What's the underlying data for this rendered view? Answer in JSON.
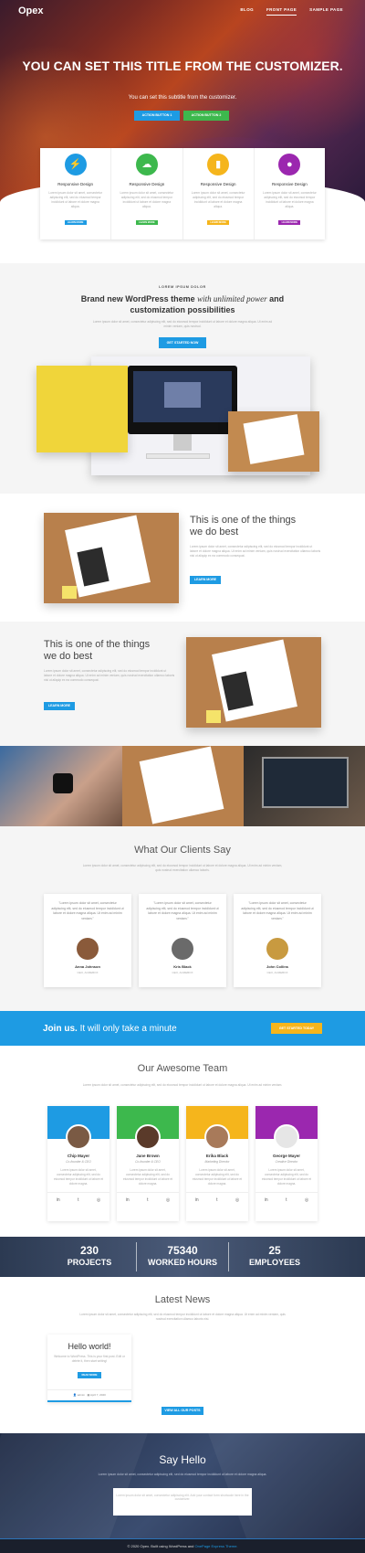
{
  "header": {
    "logo": "Opex",
    "nav": [
      "BLOG",
      "FRONT PAGE",
      "SAMPLE PAGE"
    ]
  },
  "hero": {
    "title": "YOU CAN SET THIS TITLE FROM THE CUSTOMIZER.",
    "subtitle": "You can set this subtitle from the customizer.",
    "button1": "ACTION BUTTON 1",
    "button2": "ACTION BUTTON 2"
  },
  "features": [
    {
      "title": "Responsive Design",
      "desc": "Lorem ipsum dolor sit amet, consectetur adipiscing elit, sed do eiusmod tempor incididunt ut labore et dolore magna aliqua.",
      "button": "LEARN MORE",
      "color": "#1e9be3",
      "icon": "lightning-icon"
    },
    {
      "title": "Responsive Design",
      "desc": "Lorem ipsum dolor sit amet, consectetur adipiscing elit, sed do eiusmod tempor incididunt ut labore et dolore magna aliqua.",
      "button": "LEARN MORE",
      "color": "#3db84d",
      "icon": "cloud-icon"
    },
    {
      "title": "Responsive Design",
      "desc": "Lorem ipsum dolor sit amet, consectetur adipiscing elit, sed do eiusmod tempor incididunt ut labore et dolore magna aliqua.",
      "button": "LEARN MORE",
      "color": "#f5b51c",
      "icon": "signal-bars-icon"
    },
    {
      "title": "Responsive Design",
      "desc": "Lorem ipsum dolor sit amet, consectetur adipiscing elit, sed do eiusmod tempor incididunt ut labore et dolore magna aliqua.",
      "button": "LEARN MORE",
      "color": "#9b27af",
      "icon": "user-icon"
    }
  ],
  "intro": {
    "eyebrow": "LOREM IPSUM DOLOR",
    "headline_a": "Brand new WordPress theme ",
    "headline_italic": "with unlimited power",
    "headline_b": " and customization possibilities",
    "text": "Lorem ipsum dolor sit amet, consectetur adipiscing elit, sed do eiusmod tempor incididunt ut labore et dolore magna aliqua. Ut enim ad minim veniam, quis nostrud.",
    "button": "GET STARTED NOW"
  },
  "row1": {
    "title": "This is one of the things we do best",
    "text": "Lorem ipsum dolor sit amet, consectetur adipiscing elit, sed do eiusmod tempor incididunt ut labore et dolore magna aliqua. Ut enim ad minim veniam, quis nostrud exercitation ullamco laboris nisi ut aliquip ex ea commodo consequat.",
    "button": "LEARN MORE"
  },
  "row2": {
    "title": "This is one of the things we do best",
    "text": "Lorem ipsum dolor sit amet, consectetur adipiscing elit, sed do eiusmod tempor incididunt ut labore et dolore magna aliqua. Ut enim ad minim veniam, quis nostrud exercitation ullamco laboris nisi ut aliquip ex ea commodo consequat.",
    "button": "LEARN MORE"
  },
  "clients": {
    "title": "What Our Clients Say",
    "sub": "Lorem ipsum dolor sit amet, consectetur adipiscing elit, sed do eiusmod tempor incididunt ut labore et dolore magna aliqua. Ut enim ad minim veniam, quis nostrud exercitation ullamco laboris.",
    "items": [
      {
        "quote": "\"Lorem ipsum dolor sit amet, consectetur adipiscing elit, sed do eiusmod tempor incididunt ut labore et dolore magna aliqua. Ut enim ad minim veniam.\"",
        "name": "Anna Johnson",
        "role": "CEO, ACMEBOX"
      },
      {
        "quote": "\"Lorem ipsum dolor sit amet, consectetur adipiscing elit, sed do eiusmod tempor incididunt ut labore et dolore magna aliqua. Ut enim ad minim veniam.\"",
        "name": "Kris Black",
        "role": "CEO, ACMEBOX"
      },
      {
        "quote": "\"Lorem ipsum dolor sit amet, consectetur adipiscing elit, sed do eiusmod tempor incididunt ut labore et dolore magna aliqua. Ut enim ad minim veniam.\"",
        "name": "John Collins",
        "role": "CEO, ACMEBOX"
      }
    ]
  },
  "join": {
    "bold": "Join us.",
    "rest": " It will only take a minute",
    "button": "GET STARTED TODAY"
  },
  "team": {
    "title": "Our Awesome Team",
    "sub": "Lorem ipsum dolor sit amet, consectetur adipiscing elit, sed do eiusmod tempor incididunt ut labore et dolore magna aliqua. Ut enim ad minim veniam.",
    "members": [
      {
        "name": "Chip Mayer",
        "role": "Co-founder & CEO",
        "color": "#1e9be3",
        "desc": "Lorem ipsum dolor sit amet, consectetur adipiscing elit, sed do eiusmod tempor incididunt ut labore et dolore magna."
      },
      {
        "name": "Jane Brown",
        "role": "Co-founder & CEO",
        "color": "#3db84d",
        "desc": "Lorem ipsum dolor sit amet, consectetur adipiscing elit, sed do eiusmod tempor incididunt ut labore et dolore magna."
      },
      {
        "name": "Erika Black",
        "role": "Marketing Director",
        "color": "#f5b51c",
        "desc": "Lorem ipsum dolor sit amet, consectetur adipiscing elit, sed do eiusmod tempor incididunt ut labore et dolore magna."
      },
      {
        "name": "George Mayer",
        "role": "Creative Director",
        "color": "#9b27af",
        "desc": "Lorem ipsum dolor sit amet, consectetur adipiscing elit, sed do eiusmod tempor incididunt ut labore et dolore magna."
      }
    ],
    "social": [
      "in",
      "t",
      "◎"
    ]
  },
  "stats": [
    {
      "number": "230",
      "label": "PROJECTS"
    },
    {
      "number": "75340",
      "label": "WORKED HOURS"
    },
    {
      "number": "25",
      "label": "EMPLOYEES"
    }
  ],
  "news": {
    "title": "Latest News",
    "sub": "Lorem ipsum dolor sit amet, consectetur adipiscing elit, sed do eiusmod tempor incididunt ut labore et dolore magna aliqua. Ut enim ad minim veniam, quis nostrud exercitation ullamco laboris nisi.",
    "post_title": "Hello world!",
    "post_text": "Welcome to WordPress. This is your first post. Edit or delete it, then start writing!",
    "post_button": "READ MORE",
    "post_author": "admin",
    "post_date": "April 7, 2020",
    "view_all": "VIEW ALL OUR POSTS"
  },
  "contact": {
    "title": "Say Hello",
    "sub": "Lorem ipsum dolor sit amet, consectetur adipiscing elit, sed do eiusmod tempor incididunt ut labore et dolore magna aliqua.",
    "box_text": "Lorem ipsum dolor sit amet, consectetur adipiscing elit. Add your contact form shortcode here in the customizer."
  },
  "footer": {
    "text": "© 2020 Opex. Built using WordPress and ",
    "link": "OnePage Express Theme."
  }
}
